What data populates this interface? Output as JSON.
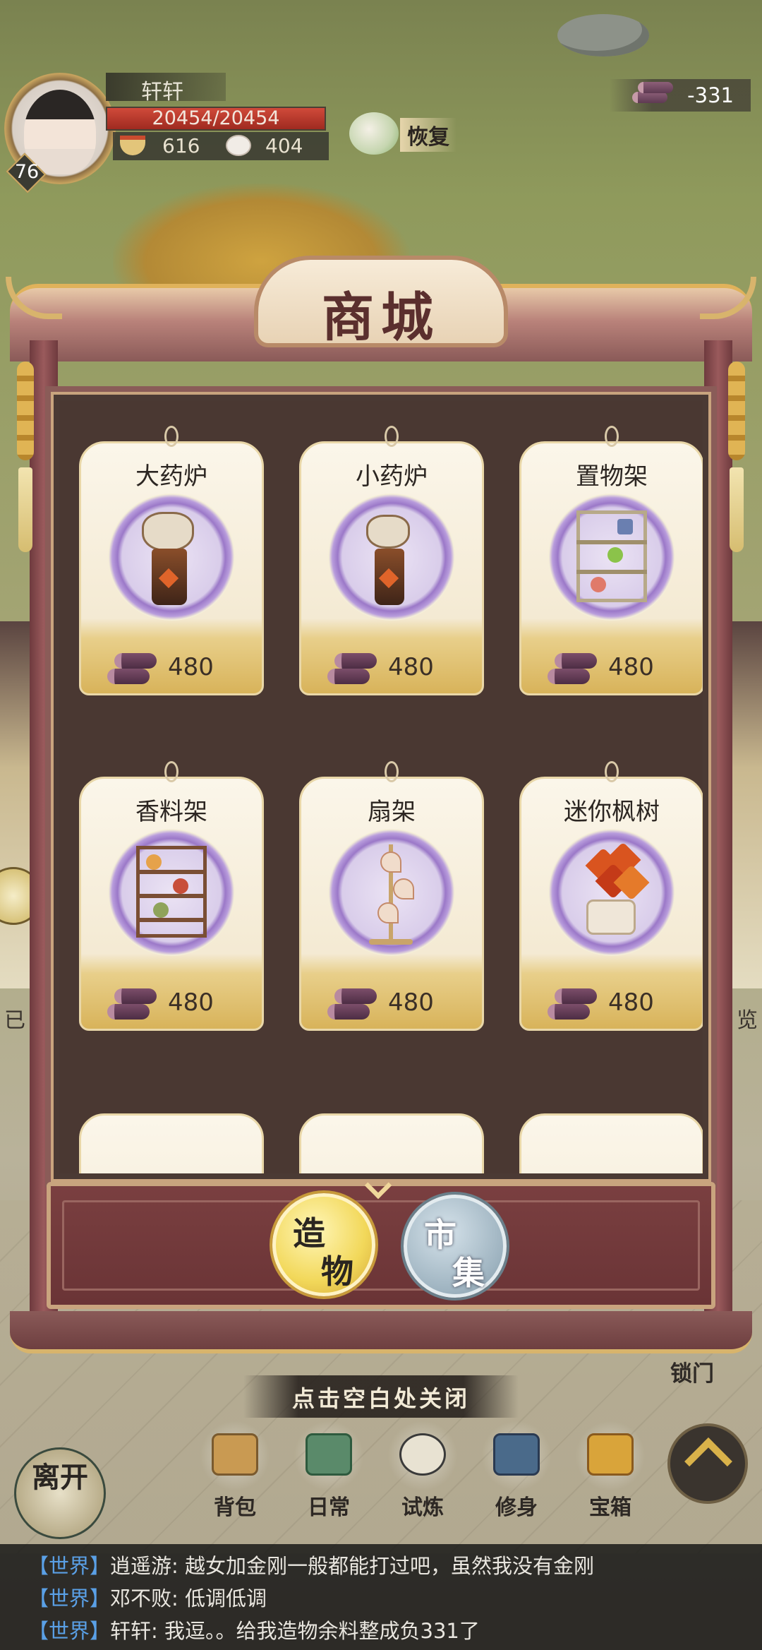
{
  "player": {
    "name": "轩轩",
    "level": "76",
    "hp_text": "20454/20454",
    "hp_fraction": 1.0,
    "stat_food": "616",
    "stat_bun": "404",
    "recover_label": "恢复"
  },
  "currency": {
    "amount": "-331",
    "icon": "wood-log-icon"
  },
  "side": {
    "left_label": "已",
    "right_label": "览",
    "lock_door": "锁门"
  },
  "shop": {
    "title": "商城",
    "items": [
      {
        "name": "大药炉",
        "price": "480",
        "icon": "large-medicine-stove-icon"
      },
      {
        "name": "小药炉",
        "price": "480",
        "icon": "small-medicine-stove-icon"
      },
      {
        "name": "置物架",
        "price": "480",
        "icon": "storage-rack-icon"
      },
      {
        "name": "香料架",
        "price": "480",
        "icon": "spice-rack-icon"
      },
      {
        "name": "扇架",
        "price": "480",
        "icon": "fan-rack-icon"
      },
      {
        "name": "迷你枫树",
        "price": "480",
        "icon": "mini-maple-tree-icon"
      }
    ],
    "tabs": {
      "active": {
        "c1": "造",
        "c2": "物"
      },
      "inactive": {
        "c1": "市",
        "c2": "集"
      }
    },
    "close_hint": "点击空白处关闭"
  },
  "nav": {
    "leave": "离开",
    "items": [
      {
        "label": "背包",
        "icon": "backpack-icon"
      },
      {
        "label": "日常",
        "icon": "daily-icon"
      },
      {
        "label": "试炼",
        "icon": "trial-icon"
      },
      {
        "label": "修身",
        "icon": "cultivation-icon"
      },
      {
        "label": "宝箱",
        "icon": "treasure-chest-icon"
      }
    ]
  },
  "chat": [
    {
      "tag": "【世界】",
      "sender": "逍遥游:",
      "text": " 越女加金刚一般都能打过吧，虽然我没有金刚"
    },
    {
      "tag": "【世界】",
      "sender": "邓不败:",
      "text": " 低调低调"
    },
    {
      "tag": "【世界】",
      "sender": "轩轩:",
      "text": " 我逗。。给我造物余料整成负331了"
    }
  ]
}
